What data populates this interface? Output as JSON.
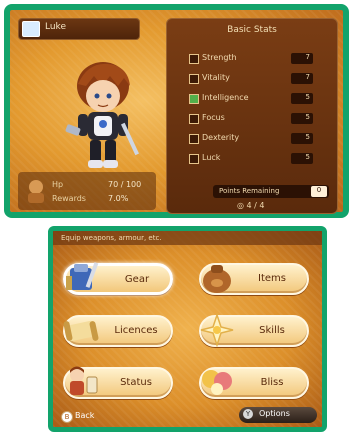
{
  "top_screen": {
    "character_name": "Luke",
    "info": [
      {
        "label": "Hp",
        "value": "70 / 100"
      },
      {
        "label": "Rewards",
        "value": "7.0%"
      }
    ],
    "stats_panel": {
      "title": "Basic Stats",
      "stats": [
        {
          "name": "Strength",
          "value": "7",
          "checked": false
        },
        {
          "name": "Vitality",
          "value": "7",
          "checked": false
        },
        {
          "name": "Intelligence",
          "value": "5",
          "checked": true
        },
        {
          "name": "Focus",
          "value": "5",
          "checked": false
        },
        {
          "name": "Dexterity",
          "value": "5",
          "checked": false
        },
        {
          "name": "Luck",
          "value": "5",
          "checked": false
        }
      ],
      "remaining_label": "Points Remaining",
      "remaining_value": "0",
      "page_indicator": "4 / 4"
    }
  },
  "bottom_screen": {
    "header": "Equip weapons, armour, etc.",
    "menu": [
      {
        "label": "Gear",
        "icon": "armor-icon",
        "selected": true
      },
      {
        "label": "Items",
        "icon": "bag-icon",
        "selected": false
      },
      {
        "label": "Licences",
        "icon": "scroll-icon",
        "selected": false
      },
      {
        "label": "Skills",
        "icon": "sparkle-icon",
        "selected": false
      },
      {
        "label": "Status",
        "icon": "character-icon",
        "selected": false
      },
      {
        "label": "Bliss",
        "icon": "bliss-icon",
        "selected": false
      }
    ],
    "back_label": "Back",
    "back_icon_glyph": "B",
    "options_label": "Options",
    "options_icon_glyph": "Y"
  },
  "colors": {
    "border_green": "#12a36b",
    "panel_brown": "#5a2a0c",
    "button_cream": "#fff1cc"
  }
}
